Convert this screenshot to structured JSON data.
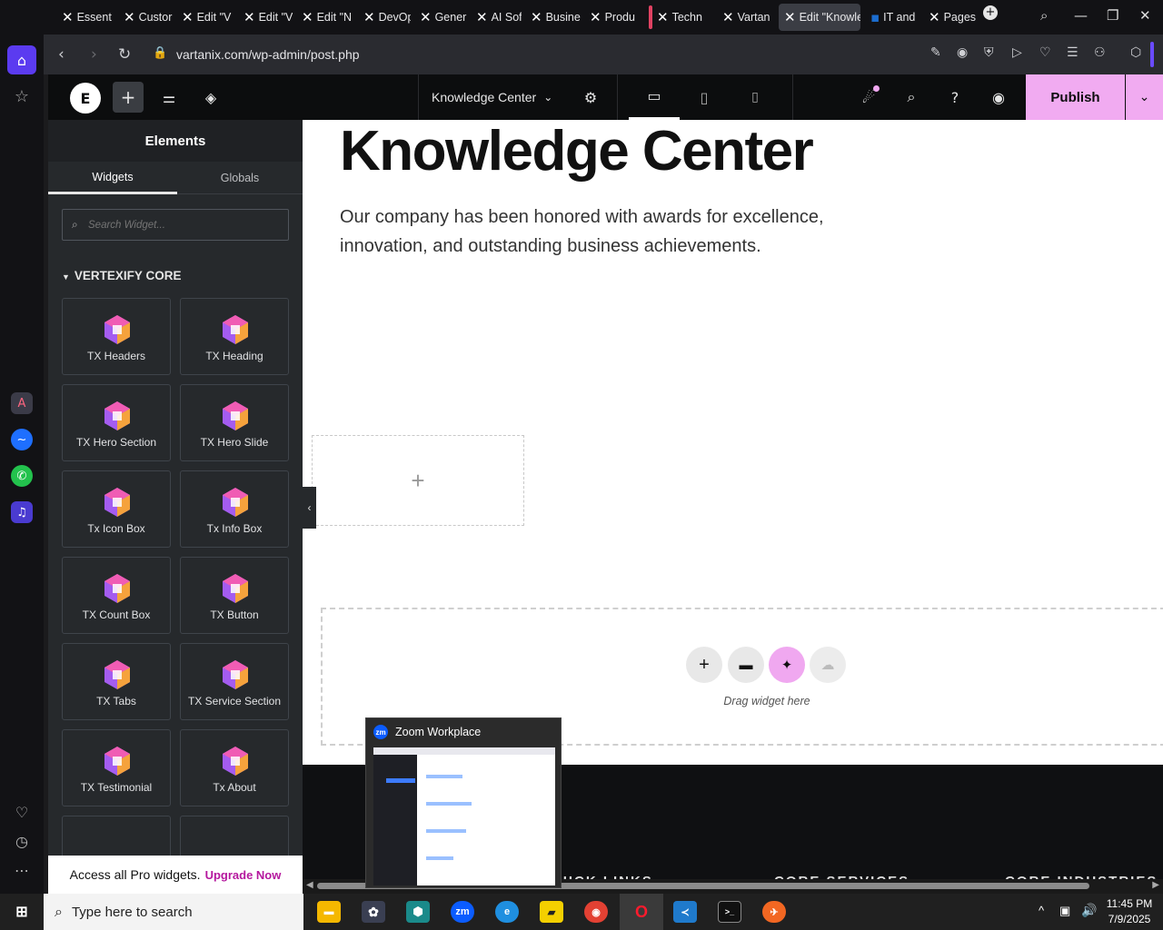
{
  "browser": {
    "tabs": [
      {
        "label": "Essent"
      },
      {
        "label": "Custor"
      },
      {
        "label": "Edit \"V"
      },
      {
        "label": "Edit \"V"
      },
      {
        "label": "Edit \"N"
      },
      {
        "label": "DevOp"
      },
      {
        "label": "Gener"
      },
      {
        "label": "AI Sof"
      },
      {
        "label": "Busine"
      },
      {
        "label": "Produ"
      },
      {
        "label": "Techn"
      },
      {
        "label": "Vartan"
      },
      {
        "label": "Edit \"Knowle"
      },
      {
        "label": "IT and"
      },
      {
        "label": "Pages"
      }
    ],
    "url": "vartanix.com/wp-admin/post.php"
  },
  "elementor": {
    "page_name": "Knowledge Center",
    "publish_label": "Publish"
  },
  "panel": {
    "title": "Elements",
    "tab_widgets": "Widgets",
    "tab_globals": "Globals",
    "search_placeholder": "Search Widget...",
    "category": "VERTEXIFY CORE",
    "widgets": [
      "TX Headers",
      "TX Heading",
      "TX Hero Section",
      "TX Hero Slide",
      "Tx Icon Box",
      "Tx Info Box",
      "TX Count Box",
      "TX Button",
      "TX Tabs",
      "TX Service Section",
      "TX Testimonial",
      "Tx About"
    ],
    "promo_text": "Access all Pro widgets.",
    "promo_link": "Upgrade Now"
  },
  "canvas": {
    "heading": "Knowledge Center",
    "paragraph_line1": "Our company has been honored with awards for excellence,",
    "paragraph_line2": "innovation, and outstanding business achievements.",
    "drag_hint": "Drag widget here",
    "footer_headings": [
      "UICK LINKS",
      "CORE SERVICES",
      "CORE INDUSTRIES"
    ]
  },
  "zoom_popup": {
    "title": "Zoom Workplace"
  },
  "taskbar": {
    "search_placeholder": "Type here to search",
    "time": "11:45 PM",
    "date": "7/9/2025"
  },
  "colors": {
    "accent_pink": "#f0a8f0",
    "publish_bg": "#f1abf1"
  }
}
